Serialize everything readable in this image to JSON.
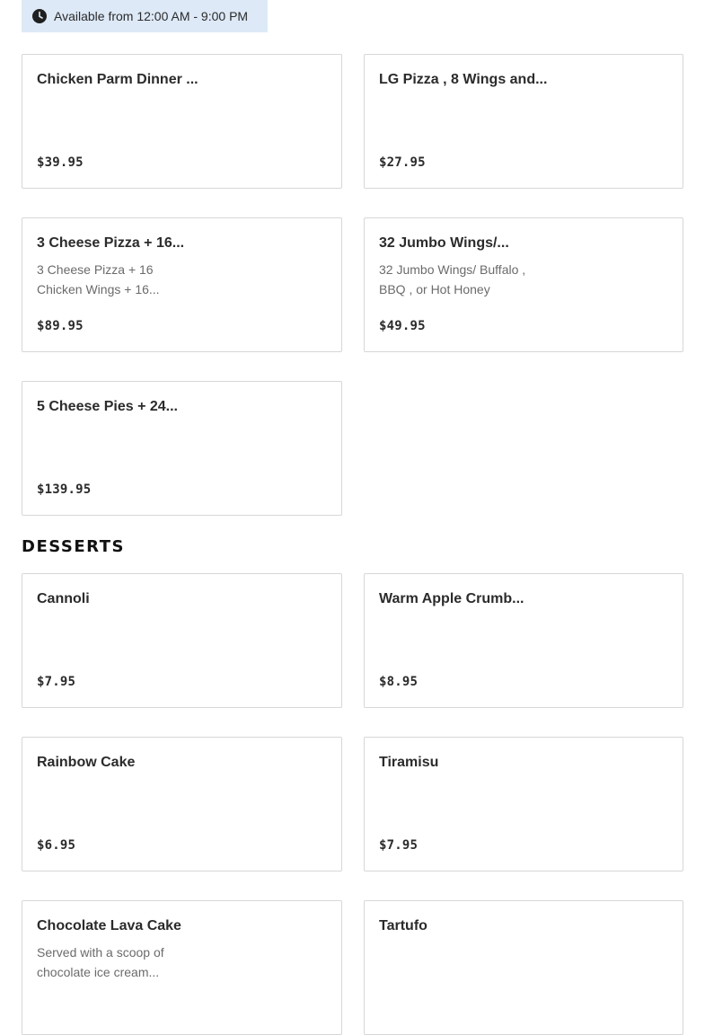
{
  "availability": {
    "text": "Available from 12:00 AM - 9:00 PM",
    "icon": "clock-icon"
  },
  "combos": [
    {
      "title": "Chicken Parm Dinner ...",
      "desc": "",
      "price": "$39.95"
    },
    {
      "title": "LG Pizza , 8 Wings and...",
      "desc": "",
      "price": "$27.95"
    },
    {
      "title": "3 Cheese Pizza + 16...",
      "desc": "3 Cheese Pizza + 16 Chicken Wings + 16...",
      "price": "$89.95"
    },
    {
      "title": "32 Jumbo Wings/...",
      "desc": "32 Jumbo Wings/ Buffalo , BBQ , or Hot Honey",
      "price": "$49.95"
    },
    {
      "title": "5 Cheese Pies + 24...",
      "desc": "",
      "price": "$139.95"
    }
  ],
  "desserts_section": {
    "title": "DESSERTS"
  },
  "desserts": [
    {
      "title": "Cannoli",
      "desc": "",
      "price": "$7.95"
    },
    {
      "title": "Warm Apple Crumb...",
      "desc": "",
      "price": "$8.95"
    },
    {
      "title": "Rainbow Cake",
      "desc": "",
      "price": "$6.95"
    },
    {
      "title": "Tiramisu",
      "desc": "",
      "price": "$7.95"
    },
    {
      "title": "Chocolate Lava Cake",
      "desc": "Served with a scoop of chocolate ice cream...",
      "price": ""
    },
    {
      "title": "Tartufo",
      "desc": "",
      "price": ""
    }
  ]
}
